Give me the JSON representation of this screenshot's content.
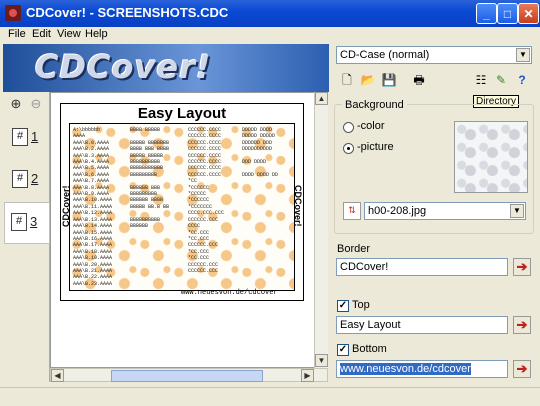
{
  "window": {
    "title": "CDCover! - SCREENSHOTS.CDC",
    "controls": {
      "minimize": "_",
      "maximize": "□",
      "close": "✕"
    }
  },
  "menu": [
    "File",
    "Edit",
    "View",
    "Help"
  ],
  "logo": {
    "text": "CDCover!"
  },
  "pages": [
    {
      "hash": "#",
      "label": "1"
    },
    {
      "hash": "#",
      "label": "2"
    },
    {
      "hash": "#",
      "label": "3",
      "selected": true
    }
  ],
  "preview": {
    "title": "Easy Layout",
    "spine_left": "CDCover!",
    "spine_right": "CDCover!",
    "footer": "www.neuesvon.de/cdcover",
    "columns": [
      "A:\\bbbbbb\nAAAA\nAAA\\B.0.AAAA\nAAA\\B.2.AAAA\nAAA\\B.3.AAAA\nAAA\\B.4.AAAA\nAAA\\B.5.AAAA\nAAA\\B.6.AAAA\nAAA\\B.7.AAAA\nAAA\\B.8.AAAA\nAAA\\B.9.AAAA\nAAA\\B.10.AAAA\nAAA\\B.11.AAAA\nAAA\\B.12.AAAA\nAAA\\B.13.AAAA\nAAA\\B.14.AAAA\nAAA\\B.15.AAAA\nAAA\\B.16.AAAA\nAAA\\B.17.AAAA\nAAA\\B.18.AAAA\nAAA\\B.19.AAAA\nAAA\\B.20.AAAA\nAAA\\B.21.AAAA\nAAA\\B.22.AAAA\nAAA\\B.23.AAAA",
      "BBBB BBBBB\n\nBBBBB BBBBBBB\nBBBB BBB BBBB\nBBBBB BBBBB\nBBBBBBBBBB\nBBBBBBBBBBB\nBBBBBBBBB\n\nBBBBBB BBB\nBBBBBBBBB\nBBBBBB BBBB\nBBBBB BB.B BB\n\nBBBBBBBBBB\nBBBBBB",
      "CCCCCC.CCCC\nCCCCCC.CCCC\nCCCCCC.CCCC\nCCCCCC.CCCC\nCCCCCC.CCCC\nCCCCCC.CCCC\nCCCCCC.CCCC\nCCCCCC.CCCC\n*CC\n*CCCCCC\n*CCCCC\n*CCCCCC\n*CCCCCCC\nCCCC.CCC.CCC\nCCCCCC.CCC\nCCCC\n*CC.CCC\n*CC.CCC\nCCCCCC.CCC\n*CC.CCC\n*CC.CCC\nCCCCCC.CCC\nCCCCCC.CCC",
      "DDDDD DDDD\nDDDDD DDDDD\nDDDDDD DDD\nDDDDDDDDDD\n\nDDD DDDD\n\nDDDD DDDD DD"
    ]
  },
  "right_panel": {
    "case_select": "CD-Case (normal)",
    "toolbar": [
      {
        "icon": "new-document-icon",
        "glyph": "🗋"
      },
      {
        "icon": "open-folder-icon",
        "glyph": "📂"
      },
      {
        "icon": "save-icon",
        "glyph": "💾"
      },
      {
        "icon": "print-icon",
        "glyph": "🖶"
      },
      {
        "icon": "directory-icon",
        "glyph": "☷"
      },
      {
        "icon": "image-tool-icon",
        "glyph": "✎"
      },
      {
        "icon": "help-icon",
        "glyph": "?"
      }
    ],
    "tooltip": "Directory",
    "background": {
      "label": "Background",
      "option_color": "-color",
      "option_picture": "-picture",
      "selected": "picture",
      "image_file": "h00-208.jpg"
    },
    "border": {
      "label": "Border",
      "value": "CDCover!"
    },
    "top": {
      "label": "Top",
      "checked": true,
      "value": "Easy Layout"
    },
    "bottom": {
      "label": "Bottom",
      "checked": true,
      "value": "www.neuesvon.de/cdcover"
    }
  },
  "colors": {
    "titlebar": "#0a4ad6",
    "accent_red": "#c0231b",
    "selection": "#316ac5"
  }
}
